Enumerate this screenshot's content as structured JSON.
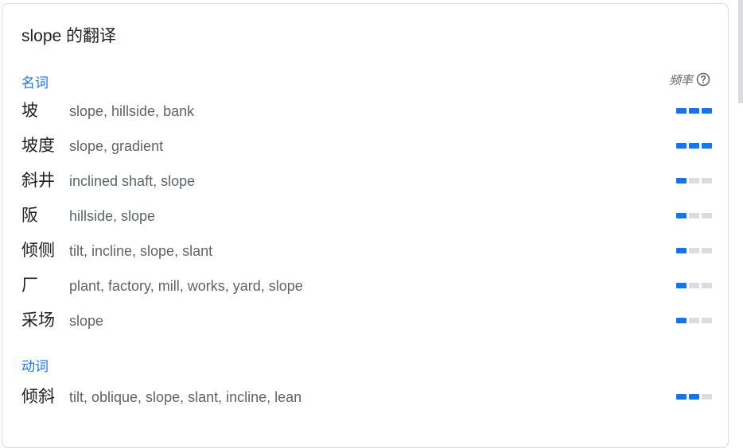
{
  "title": "slope 的翻译",
  "frequency_label": "频率",
  "colors": {
    "accent": "#1a73e8",
    "bar_off": "#dadce0",
    "text": "#202124",
    "muted": "#5f6368"
  },
  "sections": [
    {
      "pos": "名词",
      "rows": [
        {
          "word": "坡",
          "translations": "slope, hillside, bank",
          "frequency": 3
        },
        {
          "word": "坡度",
          "translations": "slope, gradient",
          "frequency": 3
        },
        {
          "word": "斜井",
          "translations": "inclined shaft, slope",
          "frequency": 1
        },
        {
          "word": "阪",
          "translations": "hillside, slope",
          "frequency": 1
        },
        {
          "word": "倾侧",
          "translations": "tilt, incline, slope, slant",
          "frequency": 1
        },
        {
          "word": "厂",
          "translations": "plant, factory, mill, works, yard, slope",
          "frequency": 1
        },
        {
          "word": "采场",
          "translations": "slope",
          "frequency": 1
        }
      ]
    },
    {
      "pos": "动词",
      "rows": [
        {
          "word": "倾斜",
          "translations": "tilt, oblique, slope, slant, incline, lean",
          "frequency": 2
        }
      ]
    }
  ]
}
